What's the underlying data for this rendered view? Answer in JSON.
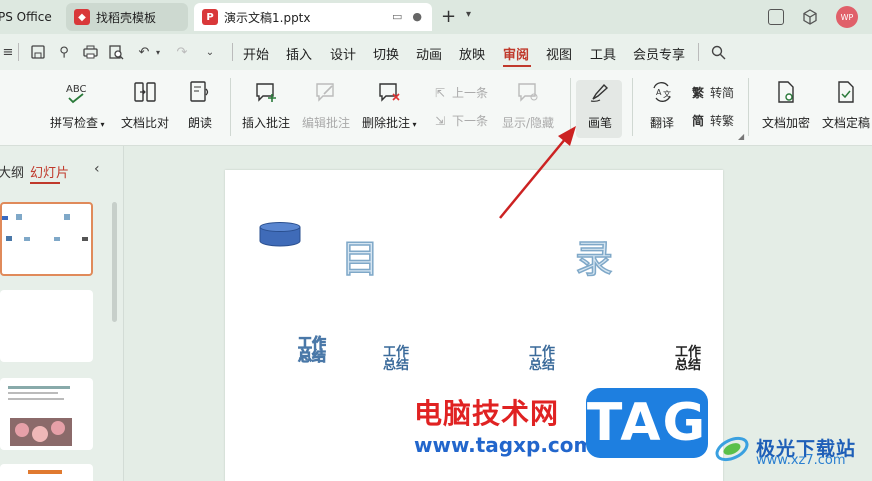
{
  "tabs": {
    "wps_label": "PS Office",
    "template_label": "找稻壳模板",
    "doc_label": "演示文稿1.pptx",
    "doc_logo": "P"
  },
  "user": {
    "avatar_initials": "WP"
  },
  "menu": {
    "items": [
      "开始",
      "插入",
      "设计",
      "切换",
      "动画",
      "放映",
      "审阅",
      "视图",
      "工具",
      "会员专享"
    ],
    "active": "审阅"
  },
  "ribbon": {
    "spell_check": "拼写检查",
    "spell_icon_text": "ABC",
    "doc_compare": "文档比对",
    "read_aloud": "朗读",
    "insert_comment": "插入批注",
    "edit_comment": "编辑批注",
    "delete_comment": "删除批注",
    "prev": "上一条",
    "next": "下一条",
    "show_hide": "显示/隐藏",
    "pen": "画笔",
    "translate": "翻译",
    "to_simplified": "转简",
    "to_traditional": "转繁",
    "simplified_glyph": "繁",
    "traditional_glyph": "简",
    "encrypt": "文档加密",
    "finalize": "文档定稿"
  },
  "left_panel": {
    "outline_tab": "大纲",
    "slides_tab": "幻灯片"
  },
  "slide": {
    "title_left": "目",
    "title_right": "录",
    "items": [
      "工作总结",
      "工作总结",
      "工作总结",
      "工作总结"
    ]
  },
  "watermark": {
    "cn": "电脑技术网",
    "url": "www.tagxp.com",
    "tag": "TAG",
    "site_name": "极光下载站",
    "site_url": "www.xz7.com"
  },
  "colors": {
    "accent": "#c0392b",
    "arrow": "#cc2222"
  }
}
